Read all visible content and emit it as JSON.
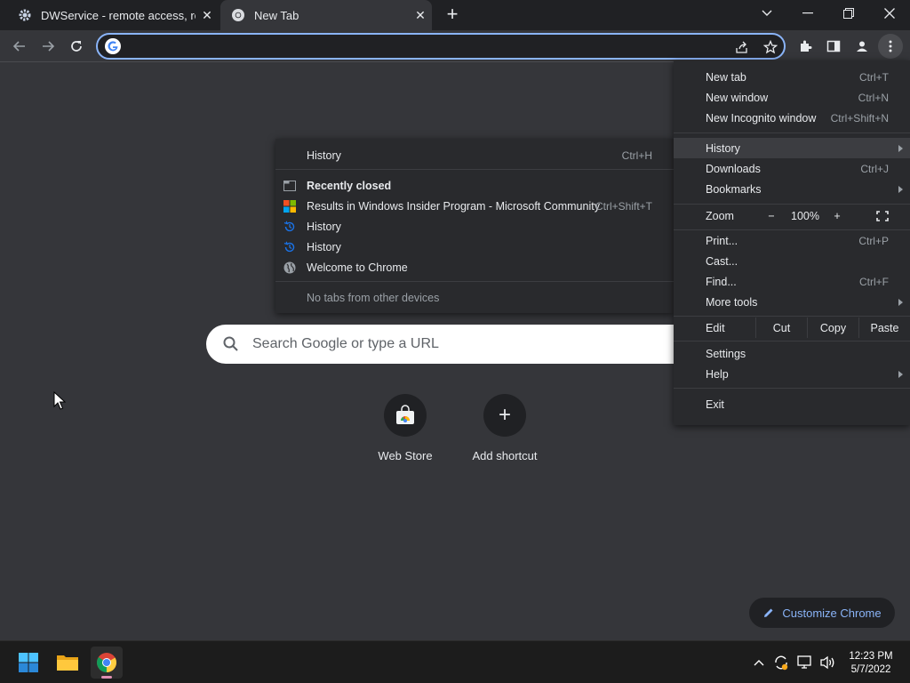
{
  "tabs": [
    {
      "title": "DWService - remote access, remote",
      "close": "✕"
    },
    {
      "title": "New Tab",
      "close": "✕"
    }
  ],
  "new_tab_button": "+",
  "omnibox": {
    "value": ""
  },
  "ntp": {
    "search_placeholder": "Search Google or type a URL",
    "shortcuts": [
      {
        "label": "Web Store",
        "icon": "web-store-icon"
      },
      {
        "label": "Add shortcut",
        "icon": "plus-icon",
        "glyph": "+"
      }
    ],
    "customize_label": "Customize Chrome"
  },
  "menu": {
    "new_tab": {
      "label": "New tab",
      "shortcut": "Ctrl+T"
    },
    "new_window": {
      "label": "New window",
      "shortcut": "Ctrl+N"
    },
    "incognito": {
      "label": "New Incognito window",
      "shortcut": "Ctrl+Shift+N"
    },
    "history": {
      "label": "History"
    },
    "downloads": {
      "label": "Downloads",
      "shortcut": "Ctrl+J"
    },
    "bookmarks": {
      "label": "Bookmarks"
    },
    "zoom": {
      "label": "Zoom",
      "minus": "−",
      "value": "100%",
      "plus": "+"
    },
    "print": {
      "label": "Print...",
      "shortcut": "Ctrl+P"
    },
    "cast": {
      "label": "Cast..."
    },
    "find": {
      "label": "Find...",
      "shortcut": "Ctrl+F"
    },
    "more_tools": {
      "label": "More tools"
    },
    "edit": {
      "label": "Edit",
      "cut": "Cut",
      "copy": "Copy",
      "paste": "Paste"
    },
    "settings": {
      "label": "Settings"
    },
    "help": {
      "label": "Help"
    },
    "exit": {
      "label": "Exit"
    }
  },
  "history_submenu": {
    "history": {
      "label": "History",
      "shortcut": "Ctrl+H"
    },
    "recently_closed": "Recently closed",
    "items": [
      {
        "label": "Results in Windows Insider Program - Microsoft Community",
        "shortcut": "Ctrl+Shift+T"
      },
      {
        "label": "History"
      },
      {
        "label": "History"
      },
      {
        "label": "Welcome to Chrome"
      }
    ],
    "no_tabs": "No tabs from other devices"
  },
  "taskbar": {
    "time": "12:23 PM",
    "date": "5/7/2022"
  },
  "colors": {
    "accent": "#8ab4f8",
    "menu_bg": "#292a2d",
    "page_bg": "#35363a"
  }
}
